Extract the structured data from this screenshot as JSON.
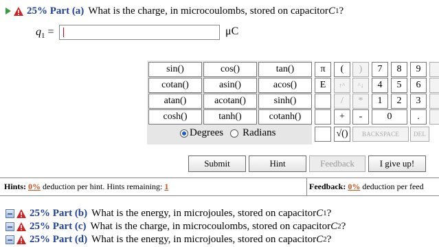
{
  "colors": {
    "accent": "#1f3f9a",
    "warning": "#cc2222",
    "play": "#3a9b3a",
    "link": "#c8501a"
  },
  "part_a": {
    "percent": "25% Part (a)",
    "question": "What is the charge, in microcoulombs, stored on capacitor ",
    "var": "C",
    "sub": "1",
    "end": "?"
  },
  "answer": {
    "label": "q",
    "label_sub": "1",
    "equals": " =",
    "value": "",
    "unit": "μC"
  },
  "functions": [
    [
      "sin()",
      "cos()",
      "tan()"
    ],
    [
      "cotan()",
      "asin()",
      "acos()"
    ],
    [
      "atan()",
      "acotan()",
      "sinh()"
    ],
    [
      "cosh()",
      "tanh()",
      "cotanh()"
    ]
  ],
  "keypad": {
    "pi": "π",
    "lparen": "(",
    "rparen": ")",
    "k7": "7",
    "k8": "8",
    "k9": "9",
    "E": "E",
    "up": "↑^",
    "down": "^↓",
    "k4": "4",
    "k5": "5",
    "k6": "6",
    "slash": "/",
    "star": "*",
    "k1": "1",
    "k2": "2",
    "k3": "3",
    "plus": "+",
    "minus": "-",
    "k0": "0",
    "dot": ".",
    "sqrt": "√()",
    "backspace": "BACKSPACE",
    "del": "DEL"
  },
  "angle": {
    "degrees": "Degrees",
    "radians": "Radians"
  },
  "buttons": {
    "submit": "Submit",
    "hint": "Hint",
    "feedback": "Feedback",
    "give_up": "I give up!"
  },
  "hints": {
    "label": "Hints:",
    "pct": "0%",
    "text": " deduction per hint. Hints remaining: ",
    "remaining": "1"
  },
  "feedback": {
    "label": "Feedback:",
    "pct": "0%",
    "text": " deduction per feed"
  },
  "parts": [
    {
      "percent": "25% Part (b)",
      "question": "What is the energy, in microjoules, stored on capacitor ",
      "var": "C",
      "sub": "1",
      "end": "?"
    },
    {
      "percent": "25% Part (c)",
      "question": "What is the charge, in microcoulombs, stored on capacitor ",
      "var": "C",
      "sub": "2",
      "end": "?"
    },
    {
      "percent": "25% Part (d)",
      "question": "What is the energy, in microjoules, stored on capacitor ",
      "var": "C",
      "sub": "2",
      "end": "?"
    }
  ]
}
